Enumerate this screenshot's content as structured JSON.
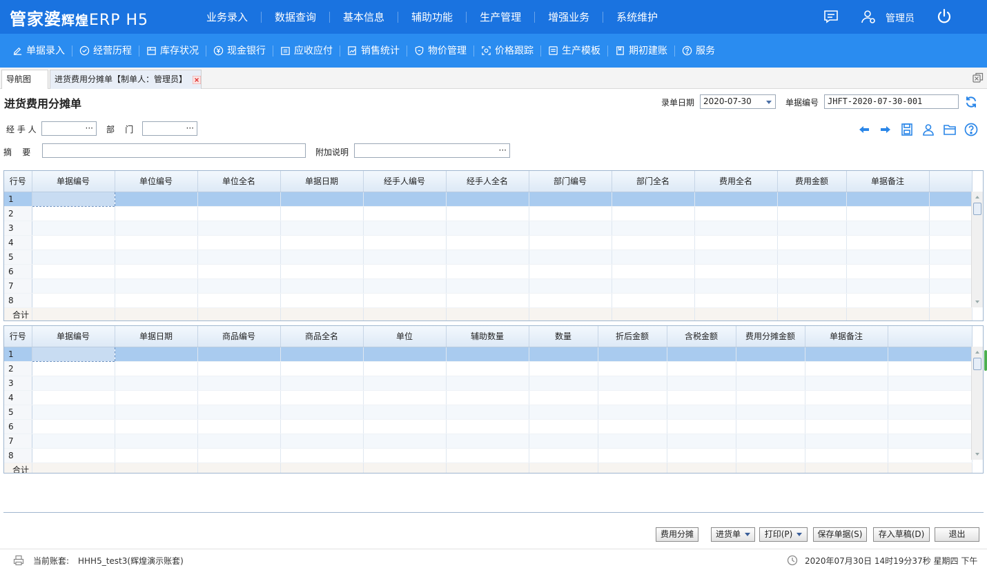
{
  "app": {
    "logo_main": "管家婆",
    "logo_sub": "辉煌",
    "logo_erp": "ERP H5",
    "top_nav": [
      "业务录入",
      "数据查询",
      "基本信息",
      "辅助功能",
      "生产管理",
      "增强业务",
      "系统维护"
    ],
    "user_name": "管理员"
  },
  "toolbar": {
    "items": [
      {
        "label": "单据录入",
        "icon": "edit-icon"
      },
      {
        "label": "经营历程",
        "icon": "check-circle-icon"
      },
      {
        "label": "库存状况",
        "icon": "box-icon"
      },
      {
        "label": "现金银行",
        "icon": "yen-icon"
      },
      {
        "label": "应收应付",
        "icon": "ledger-icon"
      },
      {
        "label": "销售统计",
        "icon": "chart-edit-icon"
      },
      {
        "label": "物价管理",
        "icon": "shield-icon"
      },
      {
        "label": "价格跟踪",
        "icon": "target-icon"
      },
      {
        "label": "生产模板",
        "icon": "template-icon"
      },
      {
        "label": "期初建账",
        "icon": "book-icon"
      },
      {
        "label": "服务",
        "icon": "help-icon"
      }
    ]
  },
  "tabs": {
    "nav_label": "导航图",
    "active_label": "进货费用分摊单【制单人：管理员】"
  },
  "form": {
    "title": "进货费用分摊单",
    "date_label": "录单日期",
    "date_value": "2020-07-30",
    "number_label": "单据编号",
    "number_value": "JHFT-2020-07-30-001",
    "handler_label": "经 手 人",
    "handler_value": "",
    "dept_label": "部    门",
    "dept_value": "",
    "summary_label": "摘    要",
    "summary_value": "",
    "note_label": "附加说明",
    "note_value": ""
  },
  "grid1": {
    "columns": [
      "行号",
      "单据编号",
      "单位编号",
      "单位全名",
      "单据日期",
      "经手人编号",
      "经手人全名",
      "部门编号",
      "部门全名",
      "费用全名",
      "费用金额",
      "单据备注"
    ],
    "rows": [
      "1",
      "2",
      "3",
      "4",
      "5",
      "6",
      "7",
      "8"
    ],
    "total_label": "合计"
  },
  "grid2": {
    "columns": [
      "行号",
      "单据编号",
      "单据日期",
      "商品编号",
      "商品全名",
      "单位",
      "辅助数量",
      "数量",
      "折后金额",
      "含税金额",
      "费用分摊金额",
      "单据备注"
    ],
    "rows": [
      "1",
      "2",
      "3",
      "4",
      "5",
      "6",
      "7",
      "8"
    ],
    "total_label": "合计"
  },
  "buttons": {
    "allocate": "费用分摊",
    "purchase": "进货单",
    "print": "打印(P)",
    "save": "保存单据(S)",
    "draft": "存入草稿(D)",
    "exit": "退出"
  },
  "status": {
    "account_label": "当前账套:",
    "account_value": "HHH5_test3(辉煌演示账套)",
    "datetime": "2020年07月30日 14时19分37秒 星期四 下午"
  },
  "colors": {
    "topbar": "#1a73e0",
    "toolbar": "#2a8cf0",
    "selected_row": "#a9cbef",
    "accent_icon": "#2a86e8"
  }
}
